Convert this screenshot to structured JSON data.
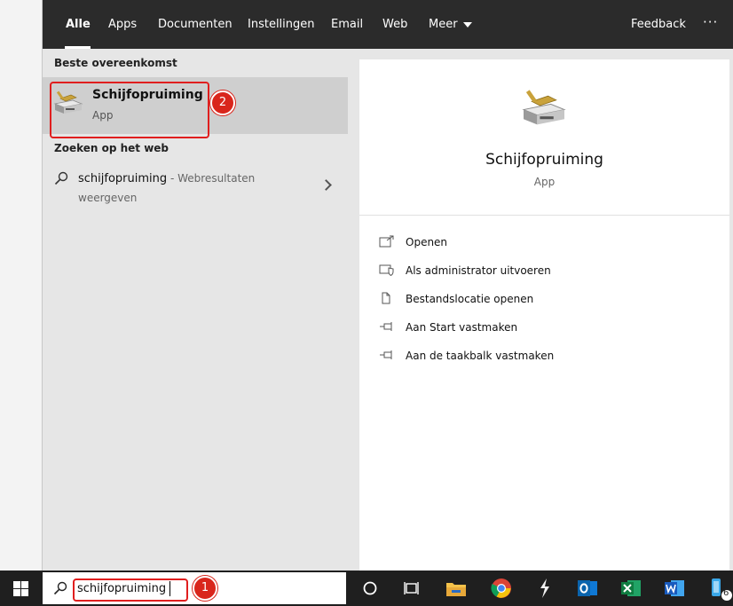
{
  "nav": {
    "tabs": [
      {
        "label": "Alle"
      },
      {
        "label": "Apps"
      },
      {
        "label": "Documenten"
      },
      {
        "label": "Instellingen"
      },
      {
        "label": "Email"
      },
      {
        "label": "Web"
      },
      {
        "label": "Meer"
      }
    ],
    "active_tab": "Alle",
    "feedback_label": "Feedback",
    "more_options": "···"
  },
  "results": {
    "best_match_header": "Beste overeenkomst",
    "best_match": {
      "title": "Schijfopruiming",
      "subtitle": "App",
      "icon": "disk-cleanup-icon"
    },
    "web_header": "Zoeken op het web",
    "web_item": {
      "query": "schijfopruiming",
      "suffix": " - Webresultaten",
      "line2": "weergeven",
      "icon": "search-icon"
    }
  },
  "preview": {
    "title": "Schijfopruiming",
    "subtitle": "App",
    "actions": [
      {
        "label": "Openen",
        "icon": "open-icon"
      },
      {
        "label": "Als administrator uitvoeren",
        "icon": "admin-shield-icon"
      },
      {
        "label": "Bestandslocatie openen",
        "icon": "file-location-icon"
      },
      {
        "label": "Aan Start vastmaken",
        "icon": "pin-icon"
      },
      {
        "label": "Aan de taakbalk vastmaken",
        "icon": "pin-icon"
      }
    ]
  },
  "taskbar": {
    "search_value": "schijfopruiming",
    "icons": [
      "windows-start-icon",
      "cortana-icon",
      "task-view-icon",
      "file-explorer-icon",
      "chrome-icon",
      "app-bolt-icon",
      "outlook-icon",
      "excel-icon",
      "word-icon",
      "phone-icon"
    ],
    "partial_badge": "6"
  },
  "annotations": {
    "badge_1": "1",
    "badge_2": "2",
    "color": "#e01e1e"
  },
  "colors": {
    "topbar": "#2b2b2b",
    "highlight": "#cfcfcf",
    "panel": "#e6e6e6",
    "taskbar": "#1f1f1f"
  }
}
